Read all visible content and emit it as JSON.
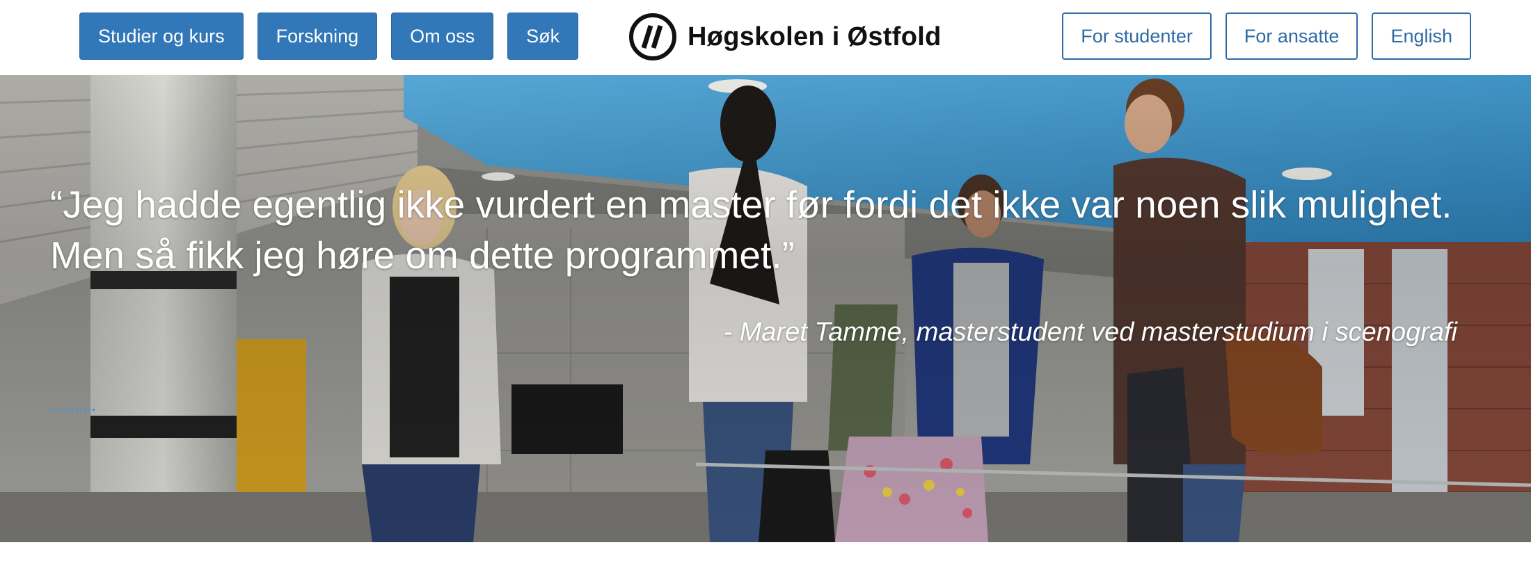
{
  "nav": {
    "left_buttons": [
      {
        "label": "Studier og kurs"
      },
      {
        "label": "Forskning"
      },
      {
        "label": "Om oss"
      },
      {
        "label": "Søk"
      }
    ],
    "right_buttons": [
      {
        "label": "For studenter"
      },
      {
        "label": "For ansatte"
      },
      {
        "label": "English"
      }
    ]
  },
  "logo": {
    "text": "Høgskolen i Østfold",
    "icon": "hiof-logo-icon"
  },
  "hero": {
    "quote": "“Jeg hadde egentlig ikke vurdert en master før fordi det ikke var noen slik mulighet. Men så fikk jeg høre om dette programmet.”",
    "attribution": "- Maret Tamme, masterstudent ved masterstudium i scenografi",
    "image": "students-walking-photo"
  },
  "colors": {
    "primary_blue": "#3278b8",
    "outline_blue": "#2e6aa5",
    "ceiling_blue": "#4aa0d4"
  }
}
